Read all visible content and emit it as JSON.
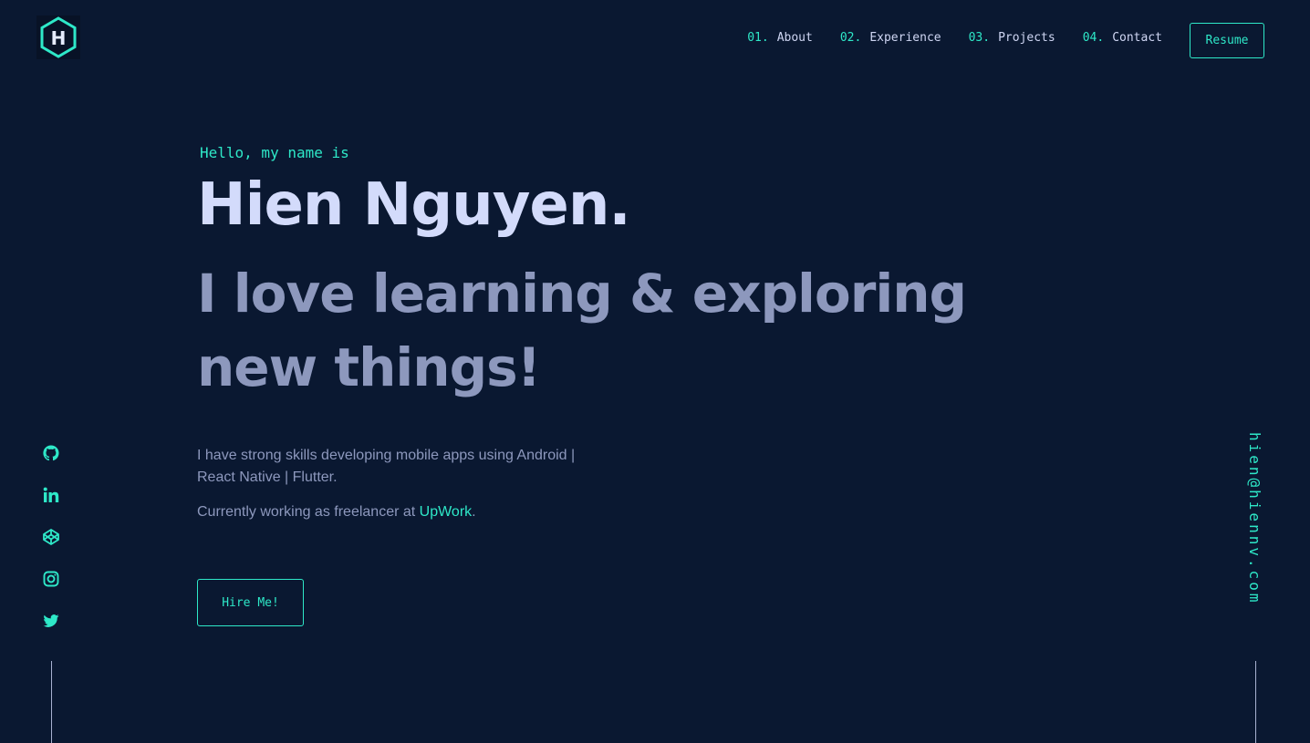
{
  "logo": {
    "letter": "H",
    "icon": "hexagon-logo-icon"
  },
  "nav": {
    "items": [
      {
        "num": "01.",
        "label": "About"
      },
      {
        "num": "02.",
        "label": "Experience"
      },
      {
        "num": "03.",
        "label": "Projects"
      },
      {
        "num": "04.",
        "label": "Contact"
      }
    ],
    "resume_label": "Resume"
  },
  "hero": {
    "greeting": "Hello, my name is",
    "name": "Hien Nguyen.",
    "tagline": "I love learning & exploring new things!",
    "description_line1": "I have strong skills developing mobile apps using Android | React Native | Flutter.",
    "description_line2_prefix": "Currently working as freelancer at ",
    "description_line2_link": "UpWork",
    "description_line2_suffix": ".",
    "hire_label": "Hire Me!"
  },
  "socials": [
    {
      "icon": "github-icon"
    },
    {
      "icon": "linkedin-icon"
    },
    {
      "icon": "codepen-icon"
    },
    {
      "icon": "instagram-icon"
    },
    {
      "icon": "twitter-icon"
    }
  ],
  "email": "hien@hiennv.com",
  "colors": {
    "background": "#0a1831",
    "accent": "#2ee8c8",
    "heading": "#d3dbfb",
    "muted": "#8d98bd"
  }
}
